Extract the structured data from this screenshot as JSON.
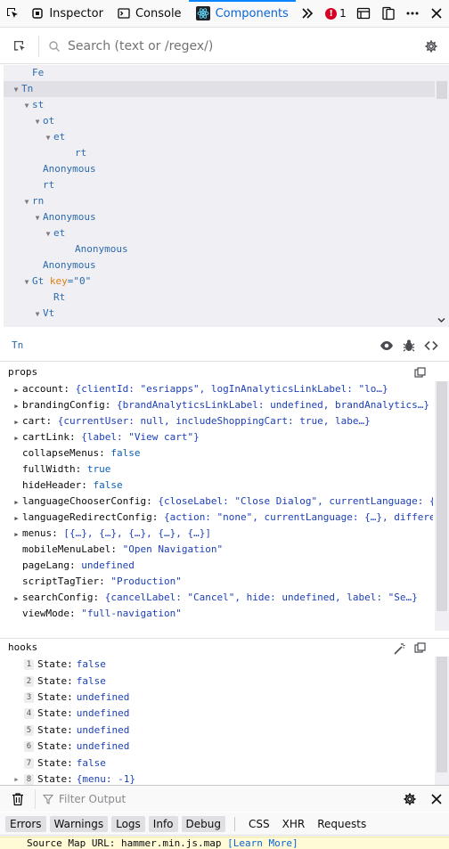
{
  "toolbar": {
    "tabs": [
      {
        "label": "Inspector",
        "icon": "inspector-icon"
      },
      {
        "label": "Console",
        "icon": "console-icon"
      },
      {
        "label": "Components",
        "icon": "react-icon",
        "active": true
      }
    ],
    "error_count": "1"
  },
  "search": {
    "placeholder": "Search (text or /regex/)"
  },
  "tree": [
    {
      "label": "Fe",
      "depth": 1,
      "toggle": ""
    },
    {
      "label": "Tn",
      "depth": 0,
      "toggle": "▼",
      "selected": true
    },
    {
      "label": "st",
      "depth": 1,
      "toggle": "▼"
    },
    {
      "label": "ot",
      "depth": 2,
      "toggle": "▼"
    },
    {
      "label": "et",
      "depth": 3,
      "toggle": "▼"
    },
    {
      "label": "rt",
      "depth": 5,
      "toggle": ""
    },
    {
      "label": "Anonymous",
      "depth": 2,
      "toggle": ""
    },
    {
      "label": "rt",
      "depth": 2,
      "toggle": ""
    },
    {
      "label": "rn",
      "depth": 1,
      "toggle": "▼"
    },
    {
      "label": "Anonymous",
      "depth": 2,
      "toggle": "▼"
    },
    {
      "label": "et",
      "depth": 3,
      "toggle": "▼"
    },
    {
      "label": "Anonymous",
      "depth": 5,
      "toggle": ""
    },
    {
      "label": "Anonymous",
      "depth": 2,
      "toggle": ""
    },
    {
      "label": "Gt",
      "depth": 1,
      "toggle": "▼",
      "attr_name": "key",
      "attr_value": "\"0\""
    },
    {
      "label": "Rt",
      "depth": 3,
      "toggle": ""
    },
    {
      "label": "Vt",
      "depth": 2,
      "toggle": "▼"
    }
  ],
  "selected_component": "Tn",
  "props": {
    "title": "props",
    "rows": [
      {
        "key": "account:",
        "value": "{clientId: \"esriapps\", logInAnalyticsLinkLabel: \"lo…}",
        "expandable": true,
        "type": "obj"
      },
      {
        "key": "brandingConfig:",
        "value": "{brandAnalyticsLinkLabel: undefined, brandAnalytics…}",
        "expandable": true,
        "type": "obj"
      },
      {
        "key": "cart:",
        "value": "{currentUser: null, includeShoppingCart: true, labe…}",
        "expandable": true,
        "type": "obj"
      },
      {
        "key": "cartLink:",
        "value": "{label: \"View cart\"}",
        "expandable": true,
        "type": "obj"
      },
      {
        "key": "collapseMenus:",
        "value": "false",
        "expandable": false,
        "type": "bool"
      },
      {
        "key": "fullWidth:",
        "value": "true",
        "expandable": false,
        "type": "bool"
      },
      {
        "key": "hideHeader:",
        "value": "false",
        "expandable": false,
        "type": "bool"
      },
      {
        "key": "languageChooserConfig:",
        "value": "{closeLabel: \"Close Dialog\", currentLanguage: {…}, …}",
        "expandable": true,
        "type": "obj"
      },
      {
        "key": "languageRedirectConfig:",
        "value": "{action: \"none\", currentLanguage: {…}, differentAck…}",
        "expandable": true,
        "type": "obj"
      },
      {
        "key": "menus:",
        "value": "[{…}, {…}, {…}, {…}, {…}]",
        "expandable": true,
        "type": "obj"
      },
      {
        "key": "mobileMenuLabel:",
        "value": "\"Open Navigation\"",
        "expandable": false,
        "type": "str"
      },
      {
        "key": "pageLang:",
        "value": "undefined",
        "expandable": false,
        "type": "undef"
      },
      {
        "key": "scriptTagTier:",
        "value": "\"Production\"",
        "expandable": false,
        "type": "str"
      },
      {
        "key": "searchConfig:",
        "value": "{cancelLabel: \"Cancel\", hide: undefined, label: \"Se…}",
        "expandable": true,
        "type": "obj"
      },
      {
        "key": "viewMode:",
        "value": "\"full-navigation\"",
        "expandable": false,
        "type": "str"
      }
    ]
  },
  "hooks": {
    "title": "hooks",
    "rows": [
      {
        "num": "1",
        "key": "State:",
        "value": "false"
      },
      {
        "num": "2",
        "key": "State:",
        "value": "false"
      },
      {
        "num": "3",
        "key": "State:",
        "value": "undefined"
      },
      {
        "num": "4",
        "key": "State:",
        "value": "undefined"
      },
      {
        "num": "5",
        "key": "State:",
        "value": "undefined"
      },
      {
        "num": "6",
        "key": "State:",
        "value": "undefined"
      },
      {
        "num": "7",
        "key": "State:",
        "value": "false"
      },
      {
        "num": "8",
        "key": "State:",
        "value": "{menu: -1}",
        "expandable": true
      }
    ]
  },
  "console": {
    "filter_placeholder": "Filter Output",
    "chips": [
      "Errors",
      "Warnings",
      "Logs",
      "Info",
      "Debug"
    ],
    "plain": [
      "CSS",
      "XHR",
      "Requests"
    ],
    "message": "Source Map URL: hammer.min.js.map",
    "learn_more": "[Learn More]"
  }
}
